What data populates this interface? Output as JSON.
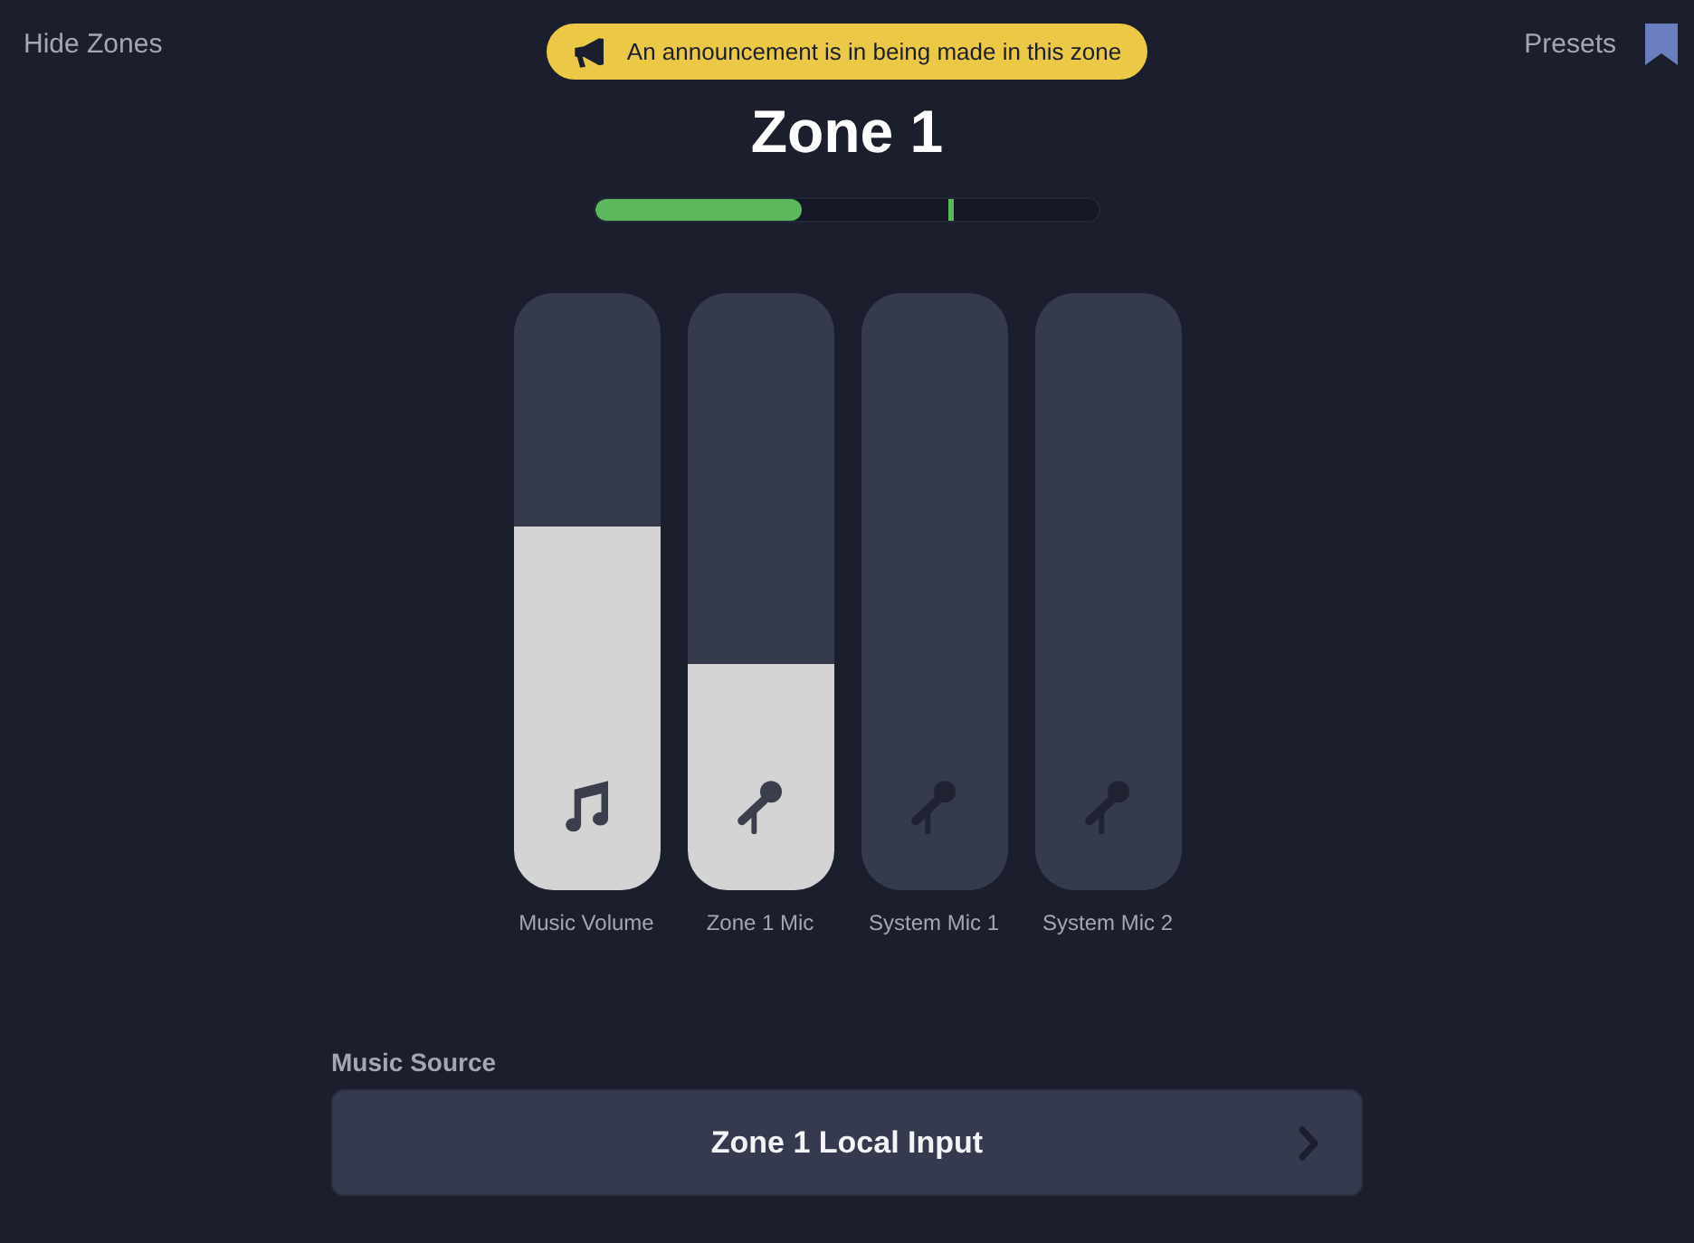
{
  "top_bar": {
    "hide_zones": "Hide Zones",
    "announcement": {
      "text": "An announcement is in being made in this zone"
    },
    "presets": "Presets"
  },
  "zone": {
    "title": "Zone 1",
    "meter": {
      "level": 0.41,
      "peak": {
        "level": 0.7
      }
    }
  },
  "faders": [
    {
      "kind": "music",
      "label": "Music Volume",
      "level": 0.61
    },
    {
      "kind": "mic",
      "label": "Zone 1 Mic",
      "level": 0.38
    },
    {
      "kind": "mic",
      "label": "System Mic 1",
      "level": 0
    },
    {
      "kind": "mic",
      "label": "System Mic 2",
      "level": 0
    }
  ],
  "music_source": {
    "label": "Music Source",
    "value": "Zone 1 Local Input"
  }
}
